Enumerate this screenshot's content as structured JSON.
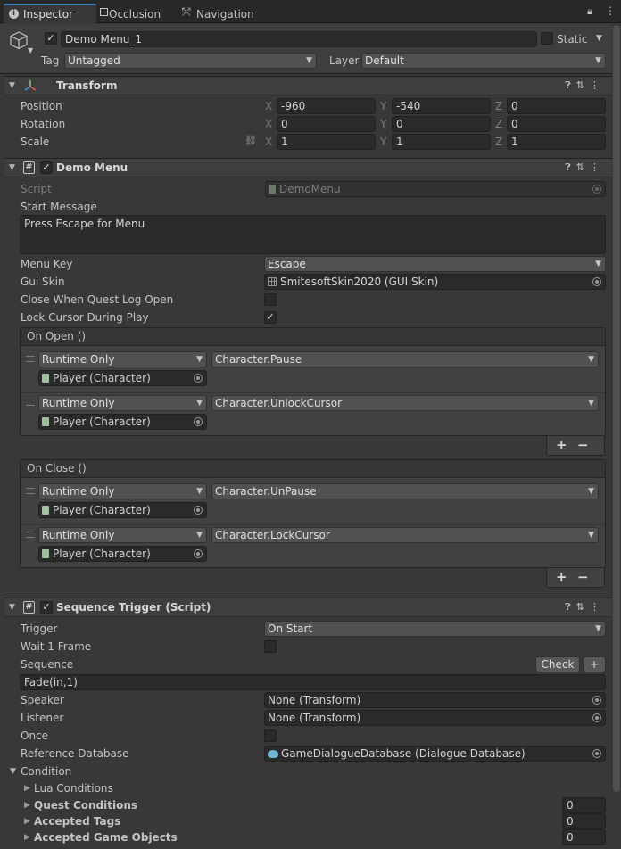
{
  "tabs": [
    {
      "label": "Inspector",
      "icon": "info-icon"
    },
    {
      "label": "Occlusion",
      "icon": "occlusion-icon"
    },
    {
      "label": "Navigation",
      "icon": "navigation-icon"
    }
  ],
  "gameobject": {
    "name": "Demo Menu_1",
    "static_label": "Static",
    "tag_label": "Tag",
    "tag_value": "Untagged",
    "layer_label": "Layer",
    "layer_value": "Default"
  },
  "transform": {
    "title": "Transform",
    "axis_x": "X",
    "axis_y": "Y",
    "axis_z": "Z",
    "position_label": "Position",
    "position": [
      "-960",
      "-540",
      "0"
    ],
    "rotation_label": "Rotation",
    "rotation": [
      "0",
      "0",
      "0"
    ],
    "scale_label": "Scale",
    "scale": [
      "1",
      "1",
      "1"
    ]
  },
  "demo_menu": {
    "title": "Demo Menu",
    "script_label": "Script",
    "script_value": "DemoMenu",
    "start_message_label": "Start Message",
    "start_message_value": "Press Escape for Menu",
    "menu_key_label": "Menu Key",
    "menu_key_value": "Escape",
    "gui_skin_label": "Gui Skin",
    "gui_skin_value": "SmitesoftSkin2020 (GUI Skin)",
    "close_when_label": "Close When Quest Log Open",
    "lock_cursor_label": "Lock Cursor During Play",
    "on_open_label": "On Open ()",
    "on_close_label": "On Close ()",
    "runtime_only": "Runtime Only",
    "player_character": "Player (Character)",
    "open_funcs": [
      "Character.Pause",
      "Character.UnlockCursor"
    ],
    "close_funcs": [
      "Character.UnPause",
      "Character.LockCursor"
    ],
    "plus": "+",
    "minus": "−"
  },
  "sequence_trigger": {
    "title": "Sequence Trigger (Script)",
    "trigger_label": "Trigger",
    "trigger_value": "On Start",
    "wait_label": "Wait 1 Frame",
    "sequence_label": "Sequence",
    "check_button": "Check",
    "add_button": "+",
    "sequence_value": "Fade(in,1)",
    "speaker_label": "Speaker",
    "speaker_value": "None (Transform)",
    "listener_label": "Listener",
    "listener_value": "None (Transform)",
    "once_label": "Once",
    "refdb_label": "Reference Database",
    "refdb_value": "GameDialogueDatabase (Dialogue Database)",
    "condition_label": "Condition",
    "lua_conditions_label": "Lua Conditions",
    "quest_conditions_label": "Quest Conditions",
    "quest_conditions_value": "0",
    "accepted_tags_label": "Accepted Tags",
    "accepted_tags_value": "0",
    "accepted_objects_label": "Accepted Game Objects",
    "accepted_objects_value": "0"
  }
}
